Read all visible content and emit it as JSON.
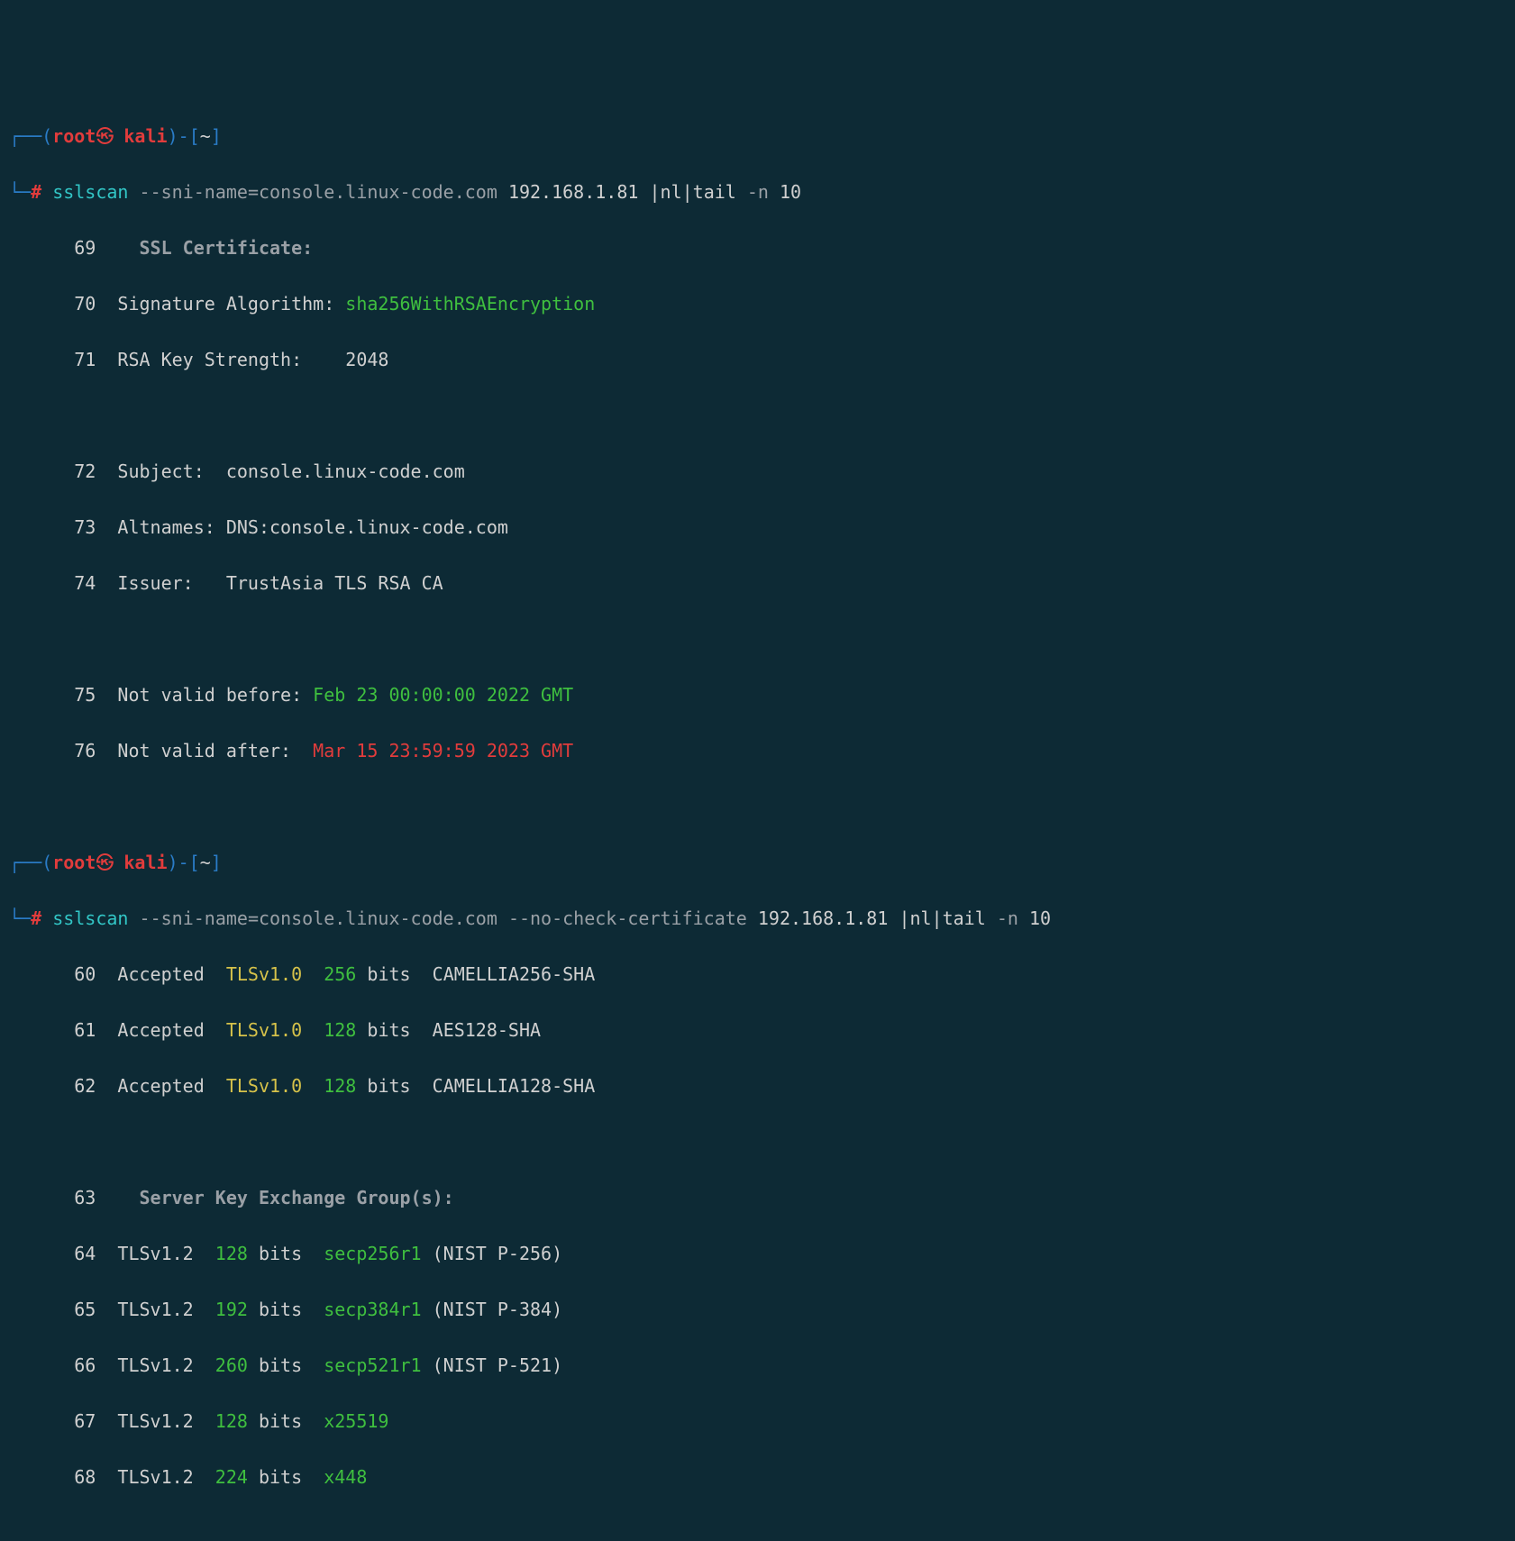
{
  "prompt": {
    "box_open": "┌──(",
    "user": "root",
    "skull": "㉿",
    "host": "kali",
    "after_host": ")-[",
    "cwd": "~",
    "close_bracket": "]",
    "bottom_corner": "└─",
    "hash": "#"
  },
  "cmd1": {
    "bin": "sslscan",
    "opt1": "--sni-name=console.linux-code.com",
    "target": "192.168.1.81",
    "pipe1": "|nl|tail",
    "flag_n": "-n",
    "num": "10"
  },
  "cmd2": {
    "bin": "sslscan",
    "opt1": "--sni-name=console.linux-code.com",
    "opt2": "--no-check-certificate",
    "target": "192.168.1.81",
    "pipe1": "|nl|tail",
    "flag_n": "-n",
    "num": "10"
  },
  "out1": {
    "l69n": "69",
    "l69t": "SSL Certificate:",
    "l70n": "70",
    "l70a": "Signature Algorithm: ",
    "l70b": "sha256WithRSAEncryption",
    "l71n": "71",
    "l71a": "RSA Key Strength:    2048",
    "l72n": "72",
    "l72a": "Subject:  console.linux-code.com",
    "l73n": "73",
    "l73a": "Altnames: DNS:console.linux-code.com",
    "l74n": "74",
    "l74a": "Issuer:   TrustAsia TLS RSA CA",
    "l75n": "75",
    "l75a": "Not valid before: ",
    "l75b": "Feb 23 00:00:00 2022 GMT",
    "l76n": "76",
    "l76a": "Not valid after:  ",
    "l76b": "Mar 15 23:59:59 2023 GMT"
  },
  "out2": {
    "l60n": "60",
    "l60a": "Accepted  ",
    "l60tls": "TLSv1.0",
    "l60bits": "  256",
    "l60rest": " bits  CAMELLIA256-SHA",
    "l61n": "61",
    "l61a": "Accepted  ",
    "l61tls": "TLSv1.0",
    "l61bits": "  128",
    "l61rest": " bits  AES128-SHA",
    "l62n": "62",
    "l62a": "Accepted  ",
    "l62tls": "TLSv1.0",
    "l62bits": "  128",
    "l62rest": " bits  CAMELLIA128-SHA",
    "l63n": "63",
    "l63t": "Server Key Exchange Group(s):",
    "l64n": "64",
    "l64a": "TLSv1.2  ",
    "l64bits": "128",
    "l64mid": " bits  ",
    "l64g": "secp256r1",
    "l64tail": " (NIST P-256)",
    "l65n": "65",
    "l65a": "TLSv1.2  ",
    "l65bits": "192",
    "l65mid": " bits  ",
    "l65g": "secp384r1",
    "l65tail": " (NIST P-384)",
    "l66n": "66",
    "l66a": "TLSv1.2  ",
    "l66bits": "260",
    "l66mid": " bits  ",
    "l66g": "secp521r1",
    "l66tail": " (NIST P-521)",
    "l67n": "67",
    "l67a": "TLSv1.2  ",
    "l67bits": "128",
    "l67mid": " bits  ",
    "l67g": "x25519",
    "l68n": "68",
    "l68a": "TLSv1.2  ",
    "l68bits": "224",
    "l68mid": " bits  ",
    "l68g": "x448"
  }
}
